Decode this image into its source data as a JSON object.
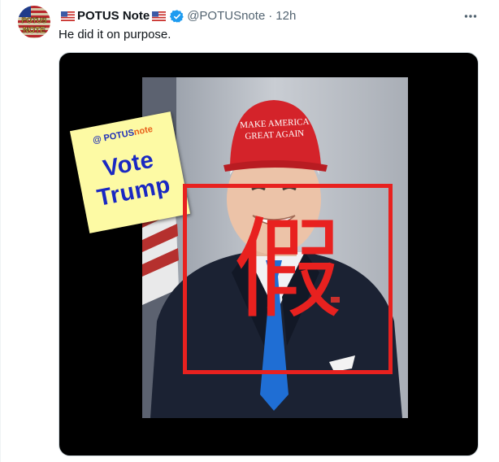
{
  "tweet": {
    "display_name": "POTUS Note",
    "handle": "@POTUSnote",
    "separator": "·",
    "time": "12h",
    "text": "He did it on purpose.",
    "avatar_text_top": "POTUS",
    "avatar_text_bottom": "NOTE",
    "flag_icon": "us-flag-icon",
    "verified_icon": "verified-badge-icon",
    "more_icon": "more-options-icon"
  },
  "media": {
    "sticky_note": {
      "brand_prefix": "@ POTUS",
      "brand_suffix": "note",
      "line1": "Vote",
      "line2": "Trump"
    },
    "hat_text_line1": "MAKE AMERICA",
    "hat_text_line2": "GREAT AGAIN",
    "fake_stamp_char": "假"
  },
  "colors": {
    "accent": "#1d9bf0",
    "stamp_red": "#e8211f",
    "sticky_blue": "#1a28c2",
    "sticky_bg": "#fdfaa4",
    "secondary_text": "#536471"
  }
}
